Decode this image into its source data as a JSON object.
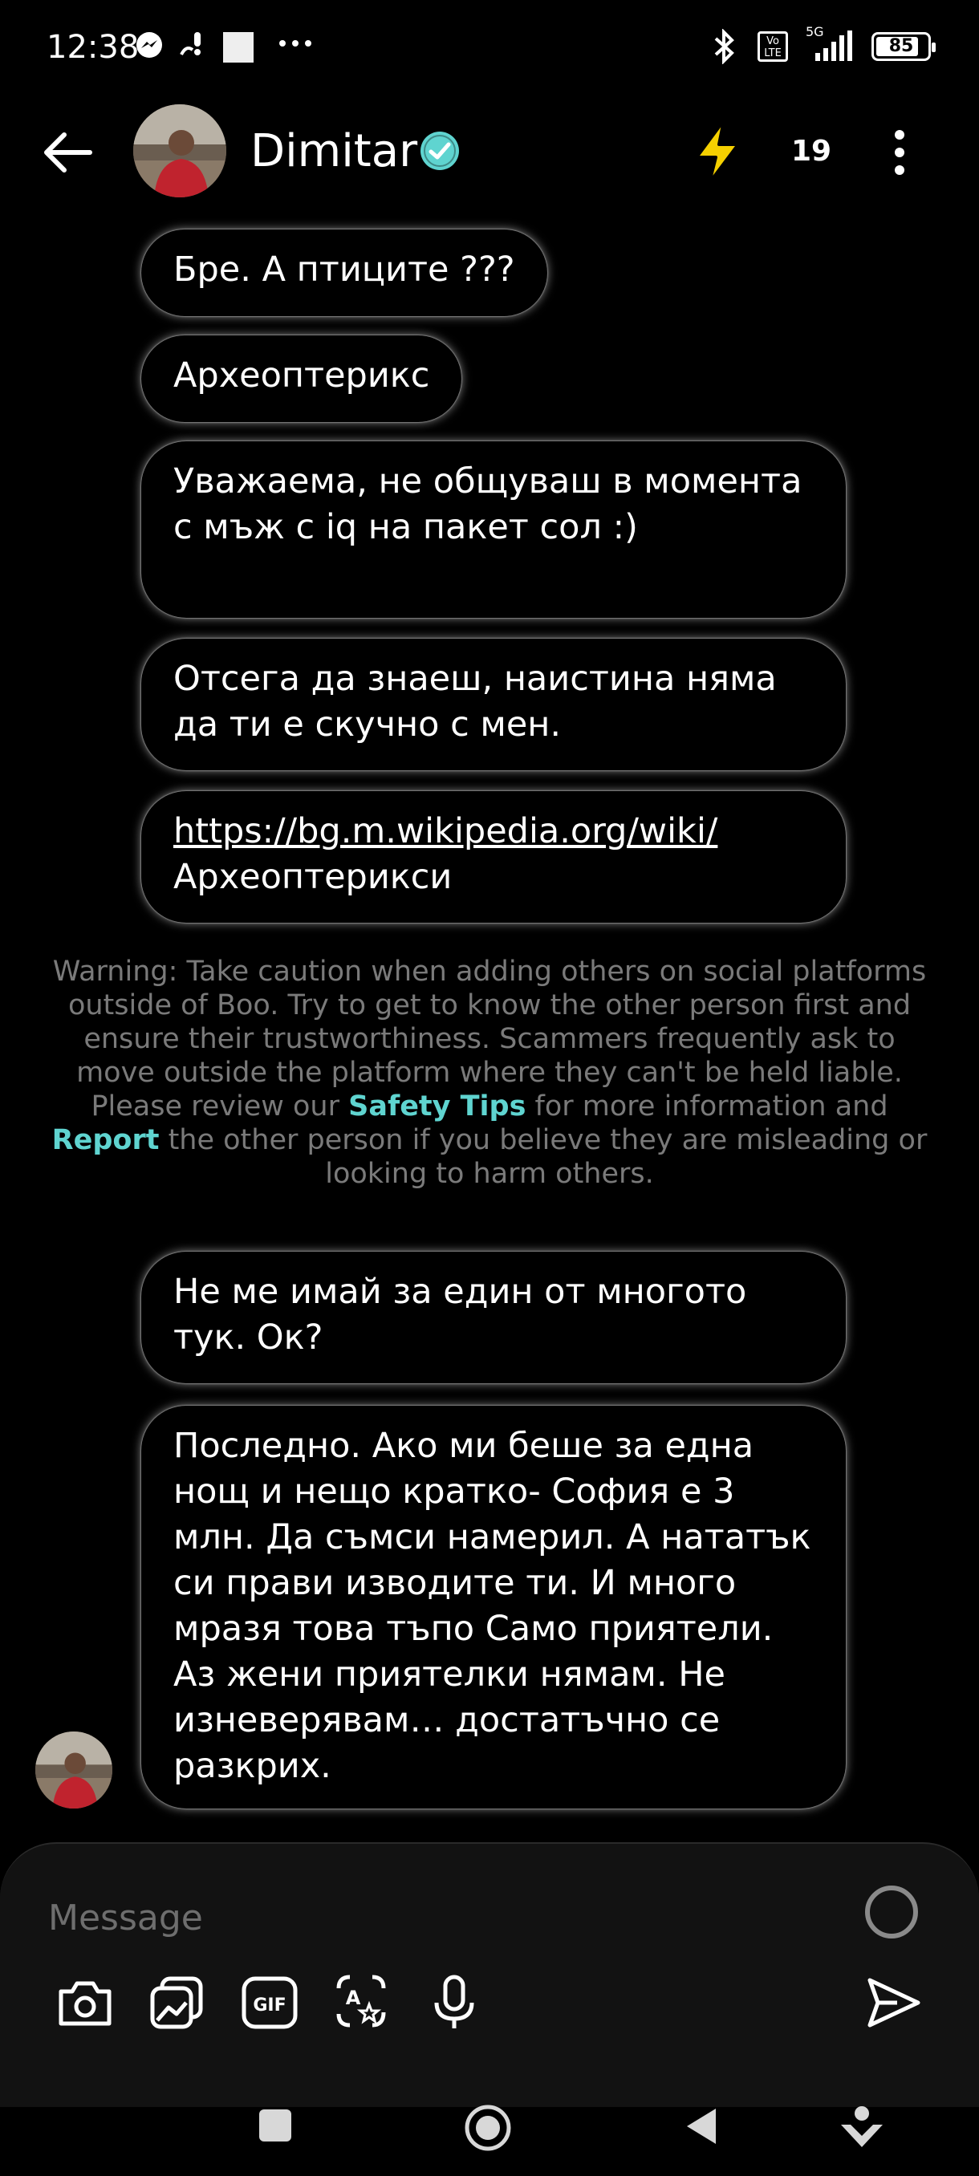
{
  "status_bar": {
    "time": "12:38",
    "network": "5G",
    "volte": "Vo LTE",
    "battery": "85"
  },
  "header": {
    "name": "Dimitar",
    "count": "19"
  },
  "messages": [
    {
      "text": "Бре. А птиците ???"
    },
    {
      "text": "Археоптерикс"
    },
    {
      "text": "Уважаема, не общуваш в моментa с мъж с iq на пакет сол :)"
    },
    {
      "text": "Отсега да знаеш, наистина няма да ти е скучно с мен."
    },
    {
      "link": "https://bg.m.wikipedia.org/wiki/",
      "text": "Археоптерикси"
    },
    {
      "text": "Не ме имай за един от многото тук. Ок?"
    },
    {
      "text": "Последно. Ако ми беше за една нощ и нещо кратко- София е 3 млн. Да съмси намерил. А нататък си прави изводите ти. И много мразя това тъпо Само приятели. Аз жени приятелки нямам. Не изневерявам… достатъчно се разкрих."
    }
  ],
  "warning": {
    "pre": "Warning: Take caution when adding others on social platforms outside of Boo. Try to get to know the other person first and ensure their trustworthiness. Scammers frequently ask to move outside the platform where they can't be held liable. Please review our ",
    "safety_tips": "Safety Tips",
    "mid": " for more information and ",
    "report": "Report",
    "post": " the other person if you believe they are misleading or looking to harm others."
  },
  "composer": {
    "placeholder": "Message",
    "tools": [
      "camera-icon",
      "gallery-icon",
      "gif-icon",
      "sticker-icon",
      "microphone-icon"
    ]
  },
  "colors": {
    "accent": "#5fd4d0",
    "bolt": "#f5d000",
    "background": "#000000"
  }
}
